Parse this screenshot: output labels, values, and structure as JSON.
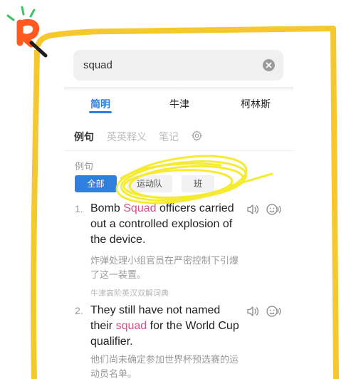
{
  "search": {
    "query": "squad"
  },
  "dict_tabs": [
    {
      "label": "简明",
      "active": true
    },
    {
      "label": "牛津",
      "active": false
    },
    {
      "label": "柯林斯",
      "active": false
    }
  ],
  "sub_tabs": [
    {
      "label": "例句",
      "active": true
    },
    {
      "label": "英英释义",
      "active": false
    },
    {
      "label": "笔记",
      "active": false
    }
  ],
  "section_label": "例句",
  "filter_chips": [
    {
      "label": "全部",
      "active": true
    },
    {
      "label": "运动队",
      "active": false
    },
    {
      "label": "班",
      "active": false
    }
  ],
  "examples": [
    {
      "number": "1.",
      "en_before": "Bomb ",
      "en_keyword": "Squad",
      "en_after": " officers carried out a controlled explosion of the device.",
      "zh": "炸弹处理小组官员在严密控制下引爆了这一装置。",
      "source": "牛津高阶英汉双解词典"
    },
    {
      "number": "2.",
      "en_before": "They still have not named their ",
      "en_keyword": "squad",
      "en_after": " for the World Cup qualifier.",
      "zh": "他们尚未确定参加世界杯预选赛的运动员名单。",
      "source": ""
    }
  ],
  "icons": [
    "clear-icon",
    "settings-gear-icon",
    "speaker-icon",
    "listen-icon",
    "brand-r-logo-icon"
  ],
  "colors": {
    "accent": "#2f7fdc",
    "keyword": "#d6508a",
    "frame": "#f6c830",
    "logo": "#ff5a1f"
  }
}
